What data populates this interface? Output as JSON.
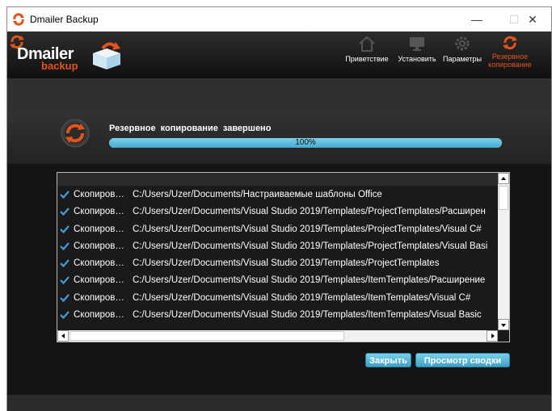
{
  "window": {
    "title": "Dmailer Backup",
    "controls": {
      "minimize": "—",
      "maximize": "☐",
      "close": "✕"
    }
  },
  "brand": {
    "name": "Dmailer",
    "sub": "backup",
    "accent": "#e3541c"
  },
  "nav": {
    "items": [
      {
        "label": "Приветствие",
        "icon": "home-icon"
      },
      {
        "label": "Установить",
        "icon": "monitor-icon"
      },
      {
        "label": "Параметры",
        "icon": "gear-icon"
      },
      {
        "label_line1": "Резервное",
        "label_line2": "копирование",
        "icon": "backup-arrows-icon",
        "active": true
      }
    ]
  },
  "status": {
    "text": "Резервное копирование завершено",
    "progress_label": "100%",
    "progress_fraction": 1.0,
    "progress_color": "#45a9d0"
  },
  "list": {
    "rows": [
      {
        "status": "Скопиров…",
        "path": "C:/Users/Uzer/Documents/Настраиваемые шаблоны Office"
      },
      {
        "status": "Скопиров…",
        "path": "C:/Users/Uzer/Documents/Visual Studio 2019/Templates/ProjectTemplates/Расширен"
      },
      {
        "status": "Скопиров…",
        "path": "C:/Users/Uzer/Documents/Visual Studio 2019/Templates/ProjectTemplates/Visual C#"
      },
      {
        "status": "Скопиров…",
        "path": "C:/Users/Uzer/Documents/Visual Studio 2019/Templates/ProjectTemplates/Visual Basi"
      },
      {
        "status": "Скопиров…",
        "path": "C:/Users/Uzer/Documents/Visual Studio 2019/Templates/ProjectTemplates"
      },
      {
        "status": "Скопиров…",
        "path": "C:/Users/Uzer/Documents/Visual Studio 2019/Templates/ItemTemplates/Расширение"
      },
      {
        "status": "Скопиров…",
        "path": "C:/Users/Uzer/Documents/Visual Studio 2019/Templates/ItemTemplates/Visual C#"
      },
      {
        "status": "Скопиров…",
        "path": "C:/Users/Uzer/Documents/Visual Studio 2019/Templates/ItemTemplates/Visual Basic"
      }
    ],
    "check_color": "#3fa0d8"
  },
  "buttons": {
    "close": "Закрыть",
    "summary": "Просмотр сводки"
  }
}
